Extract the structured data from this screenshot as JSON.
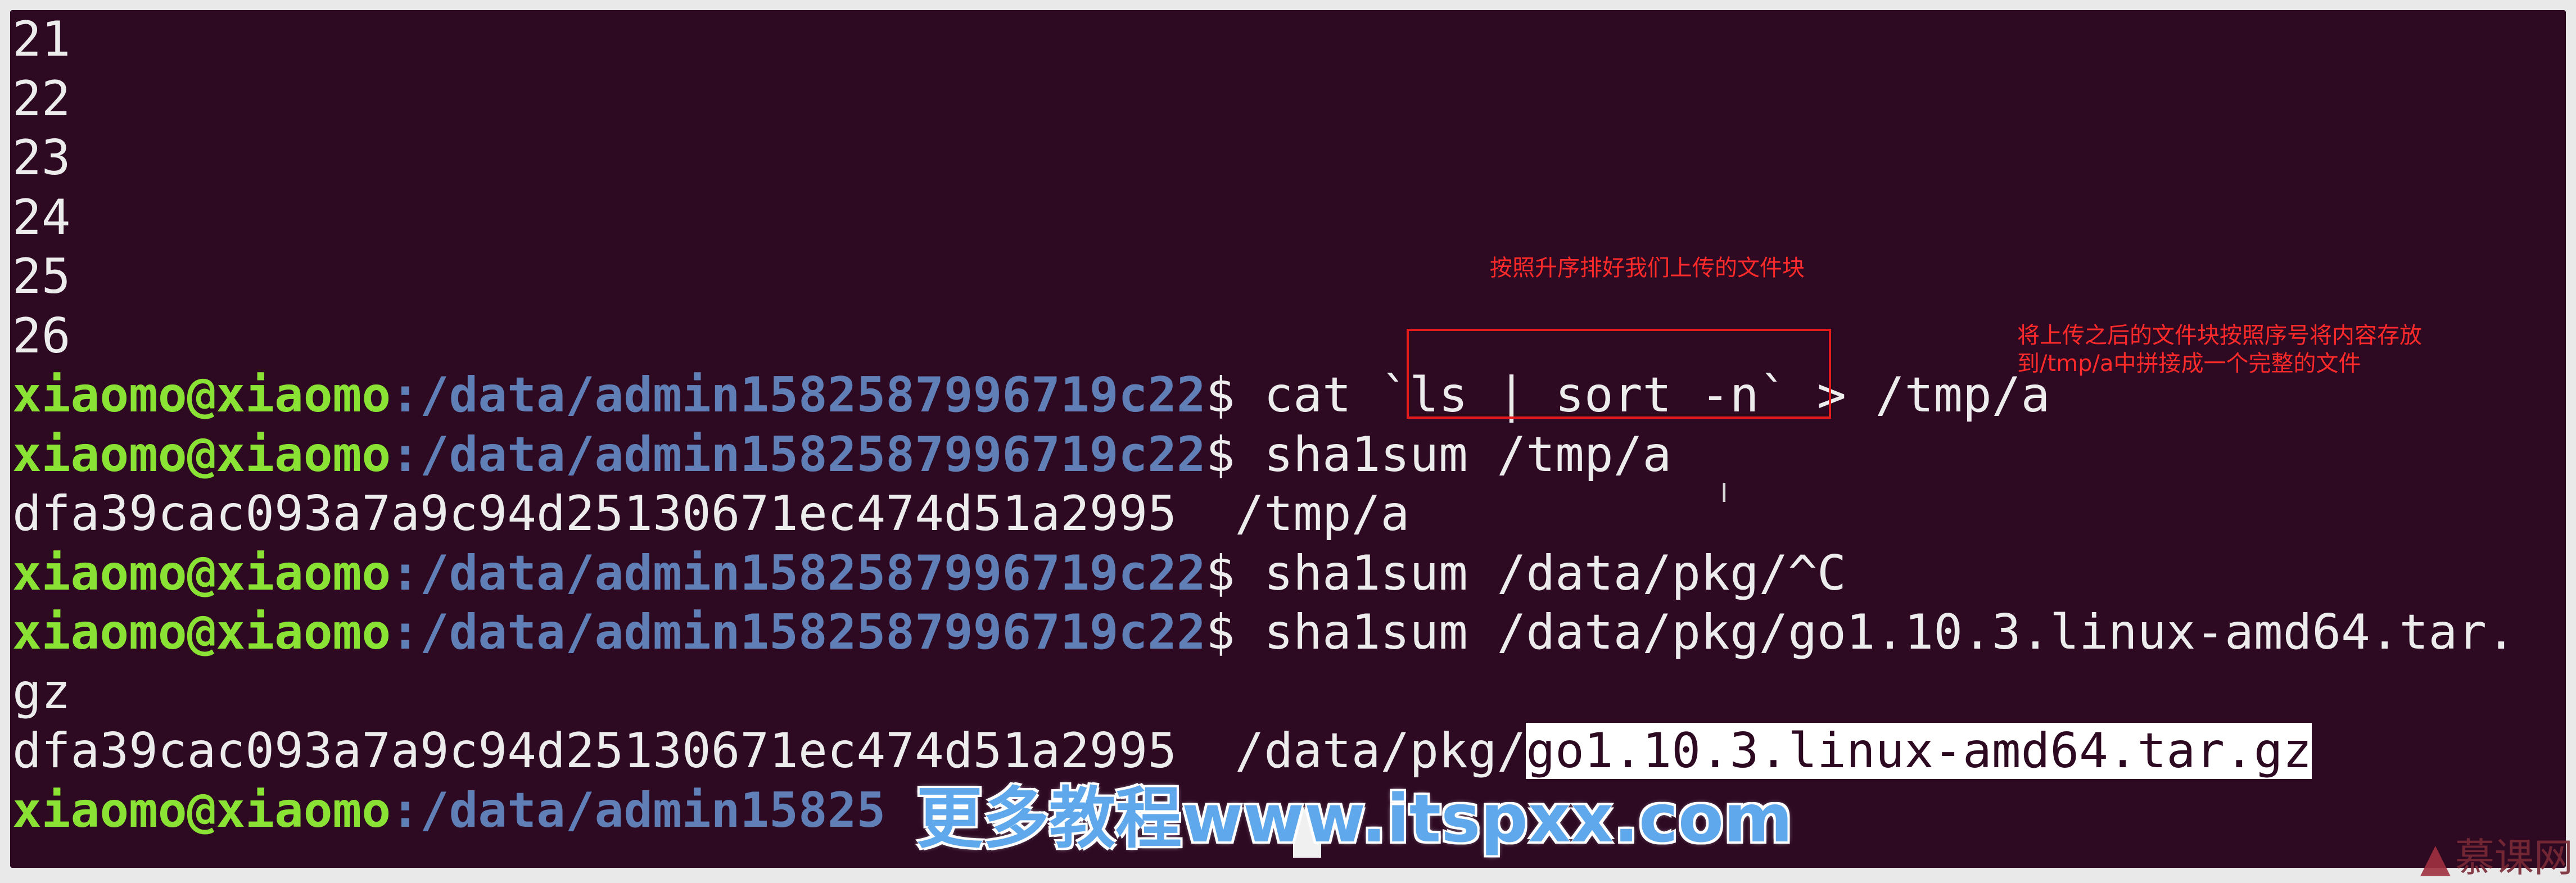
{
  "terminal": {
    "lines": [
      {
        "text": "21"
      },
      {
        "text": "22"
      },
      {
        "text": "23"
      },
      {
        "text": "24"
      },
      {
        "text": "25"
      },
      {
        "text": "26"
      },
      {
        "user": "xiaomo@xiaomo",
        "path": ":/data/admin1582587996719c22",
        "cmd": "$ cat `ls | sort -n` > /tmp/a"
      },
      {
        "user": "xiaomo@xiaomo",
        "path": ":/data/admin1582587996719c22",
        "cmd": "$ sha1sum /tmp/a"
      },
      {
        "text": "dfa39cac093a7a9c94d25130671ec474d51a2995  /tmp/a"
      },
      {
        "user": "xiaomo@xiaomo",
        "path": ":/data/admin1582587996719c22",
        "cmd": "$ sha1sum /data/pkg/^C"
      },
      {
        "user": "xiaomo@xiaomo",
        "path": ":/data/admin1582587996719c22",
        "cmd": "$ sha1sum /data/pkg/go1.10.3.linux-amd64.tar."
      },
      {
        "text": "gz"
      },
      {
        "text": "dfa39cac093a7a9c94d25130671ec474d51a2995  /data/pkg/",
        "highlight": "go1.10.3.linux-amd64.tar.gz"
      },
      {
        "user": "xiaomo@xiaomo",
        "path": ":/data/admin15825",
        "cmd": ""
      }
    ]
  },
  "annotations": {
    "sort_note": "按照升序排好我们上传的文件块",
    "merge_note_line1": "将上传之后的文件块按照序号将内容存放",
    "merge_note_line2": "到/tmp/a中拼接成一个完整的文件"
  },
  "watermark": "更多教程www.itspxx.com",
  "logo_text": "慕课网",
  "colors": {
    "background": "#2d0922",
    "user": "#8ae234",
    "path": "#5f7fb6",
    "text": "#ececec",
    "annotation": "#ff2a2a",
    "watermark": "#5fa8ec"
  }
}
